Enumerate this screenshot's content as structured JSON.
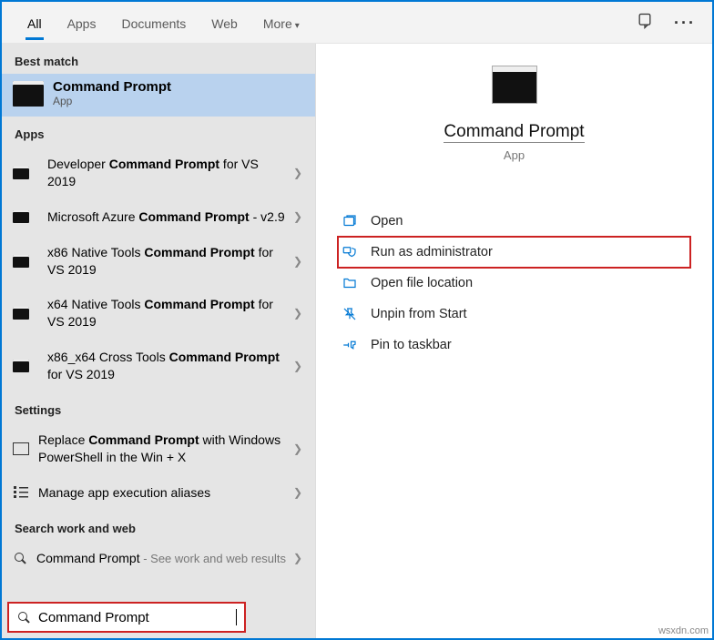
{
  "tabs": {
    "all": "All",
    "apps": "Apps",
    "documents": "Documents",
    "web": "Web",
    "more": "More"
  },
  "section": {
    "best_match": "Best match",
    "apps": "Apps",
    "settings": "Settings",
    "search_web": "Search work and web"
  },
  "best_match": {
    "title": "Command Prompt",
    "sub": "App"
  },
  "apps_list": [
    {
      "pre": "Developer ",
      "bold": "Command Prompt",
      "post": " for VS 2019"
    },
    {
      "pre": "Microsoft Azure ",
      "bold": "Command Prompt",
      "post": " - v2.9"
    },
    {
      "pre": "x86 Native Tools ",
      "bold": "Command Prompt",
      "post": " for VS 2019"
    },
    {
      "pre": "x64 Native Tools ",
      "bold": "Command Prompt",
      "post": " for VS 2019"
    },
    {
      "pre": "x86_x64 Cross Tools ",
      "bold": "Command Prompt",
      "post": " for VS 2019"
    }
  ],
  "settings_list": [
    {
      "pre": "Replace ",
      "bold": "Command Prompt",
      "post": " with Windows PowerShell in the Win + X"
    },
    {
      "pre": "Manage app execution aliases",
      "bold": "",
      "post": ""
    }
  ],
  "web_list": {
    "label": "Command Prompt",
    "hint": " - See work and web results"
  },
  "search_value": "Command Prompt",
  "preview": {
    "title": "Command Prompt",
    "sub": "App"
  },
  "actions": {
    "open": "Open",
    "runadmin": "Run as administrator",
    "filelocation": "Open file location",
    "unpin": "Unpin from Start",
    "pintaskbar": "Pin to taskbar"
  },
  "watermark": "wsxdn.com"
}
